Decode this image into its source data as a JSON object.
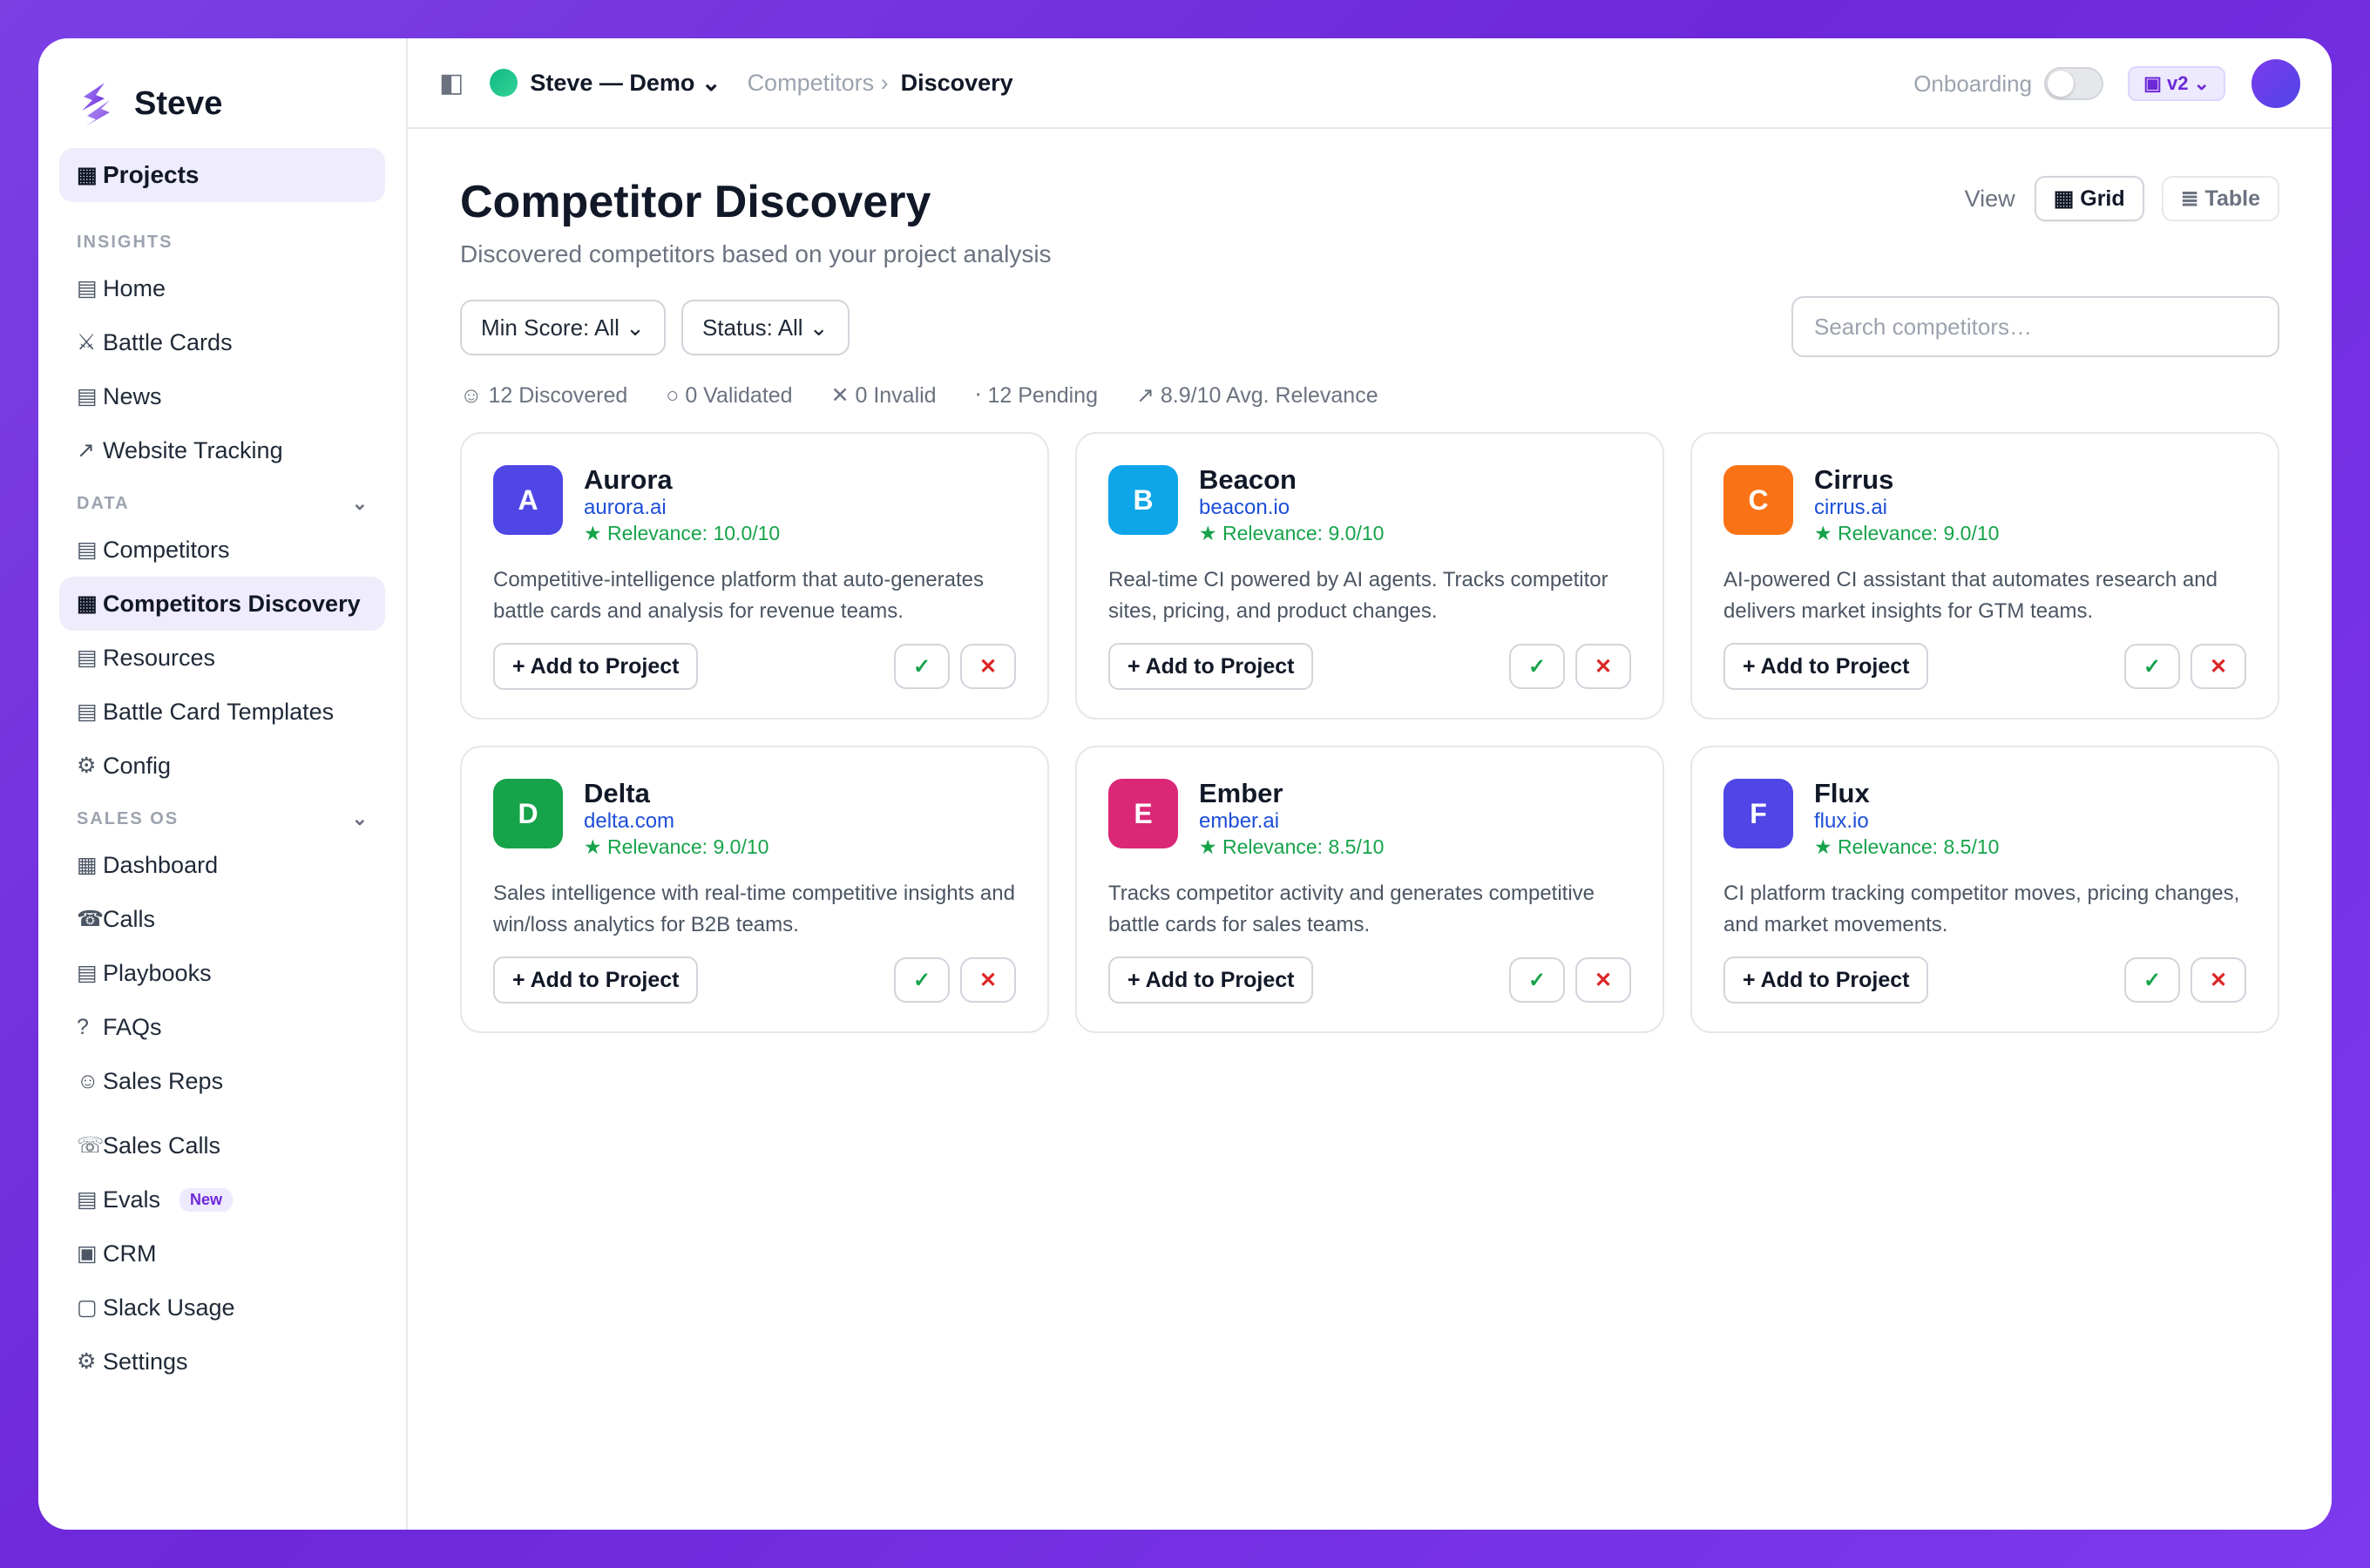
{
  "app": {
    "name": "Steve"
  },
  "sidebar": {
    "projects_label": "Projects",
    "sections": {
      "insights": "INSIGHTS",
      "data": "DATA",
      "sales_os": "SALES OS"
    },
    "insights_items": [
      {
        "icon": "▤",
        "label": "Home"
      },
      {
        "icon": "⚔",
        "label": "Battle Cards"
      },
      {
        "icon": "▤",
        "label": "News"
      },
      {
        "icon": "↗",
        "label": "Website Tracking"
      }
    ],
    "data_items": [
      {
        "icon": "▤",
        "label": "Competitors"
      },
      {
        "icon": "▦",
        "label": "Competitors Discovery"
      },
      {
        "icon": "▤",
        "label": "Resources"
      },
      {
        "icon": "▤",
        "label": "Battle Card Templates"
      },
      {
        "icon": "⚙",
        "label": "Config"
      }
    ],
    "sales_items": [
      {
        "icon": "▦",
        "label": "Dashboard"
      },
      {
        "icon": "☎",
        "label": "Calls"
      },
      {
        "icon": "▤",
        "label": "Playbooks"
      },
      {
        "icon": "?",
        "label": "FAQs"
      },
      {
        "icon": "☺",
        "label": "Sales Reps"
      }
    ],
    "bottom_items": [
      {
        "icon": "☏",
        "label": "Sales Calls"
      },
      {
        "icon": "▤",
        "label": "Evals",
        "badge": "New"
      },
      {
        "icon": "▣",
        "label": "CRM"
      },
      {
        "icon": "▢",
        "label": "Slack Usage"
      },
      {
        "icon": "⚙",
        "label": "Settings"
      }
    ]
  },
  "topbar": {
    "project": "Steve — Demo ⌄",
    "breadcrumb_parent": "Competitors ›",
    "breadcrumb_current": "Discovery",
    "onboarding_label": "Onboarding",
    "version": "▣ v2 ⌄"
  },
  "page": {
    "title": "Competitor Discovery",
    "subtitle": "Discovered competitors based on your project analysis",
    "view_label": "View",
    "view_grid": "▦ Grid",
    "view_table": "≣ Table"
  },
  "filters": {
    "min_score": "Min Score: All ⌄",
    "status": "Status: All ⌄",
    "search_placeholder": "Search competitors…"
  },
  "stats": [
    "☺ 12 Discovered",
    "○ 0 Validated",
    "✕ 0 Invalid",
    "‧ 12 Pending",
    "↗ 8.9/10 Avg. Relevance"
  ],
  "card_actions": {
    "add": "+ Add to Project",
    "approve": "✓",
    "reject": "✕"
  },
  "competitors": [
    {
      "letter": "A",
      "name": "Aurora",
      "url": "aurora.ai",
      "relevance": "★ Relevance: 10.0/10",
      "color": "#4f46e5",
      "description": "Competitive-intelligence platform that auto-generates battle cards and analysis for revenue teams."
    },
    {
      "letter": "B",
      "name": "Beacon",
      "url": "beacon.io",
      "relevance": "★ Relevance: 9.0/10",
      "color": "#0ea5e9",
      "description": "Real-time CI powered by AI agents. Tracks competitor sites, pricing, and product changes."
    },
    {
      "letter": "C",
      "name": "Cirrus",
      "url": "cirrus.ai",
      "relevance": "★ Relevance: 9.0/10",
      "color": "#f97316",
      "description": "AI-powered CI assistant that automates research and delivers market insights for GTM teams."
    },
    {
      "letter": "D",
      "name": "Delta",
      "url": "delta.com",
      "relevance": "★ Relevance: 9.0/10",
      "color": "#16a34a",
      "description": "Sales intelligence with real-time competitive insights and win/loss analytics for B2B teams."
    },
    {
      "letter": "E",
      "name": "Ember",
      "url": "ember.ai",
      "relevance": "★ Relevance: 8.5/10",
      "color": "#db2777",
      "description": "Tracks competitor activity and generates competitive battle cards for sales teams."
    },
    {
      "letter": "F",
      "name": "Flux",
      "url": "flux.io",
      "relevance": "★ Relevance: 8.5/10",
      "color": "#4f46e5",
      "description": "CI platform tracking competitor moves, pricing changes, and market movements."
    }
  ]
}
